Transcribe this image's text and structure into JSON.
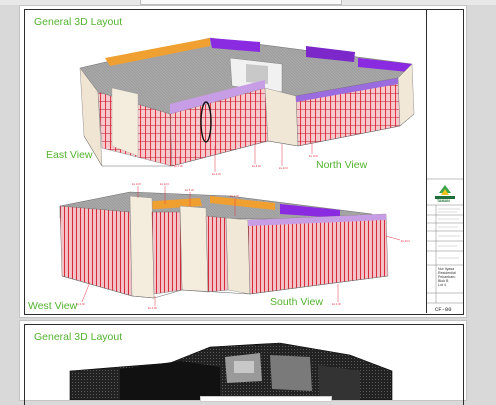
{
  "sheet1": {
    "labels": {
      "general": "General 3D Layout",
      "east": "East View",
      "north": "North View",
      "west": "West View",
      "south": "South View"
    },
    "title_block": {
      "logo_text": "TAMAN",
      "project_lines": [
        "Nur Ilyasa",
        "Residential",
        "Pekanbaru",
        "Blok B",
        "Lot 4"
      ],
      "sheet_no": "CF-00"
    }
  },
  "sheet2": {
    "labels": {
      "general": "General 3D Layout"
    }
  },
  "colors": {
    "label_green": "#53b32f",
    "facade_red": "#e5394a",
    "roof_purple": "#8a2be2",
    "roof_orange": "#f0a030",
    "wall_cream": "#f4ecdc",
    "roof_gray": "#9a9a9a"
  }
}
